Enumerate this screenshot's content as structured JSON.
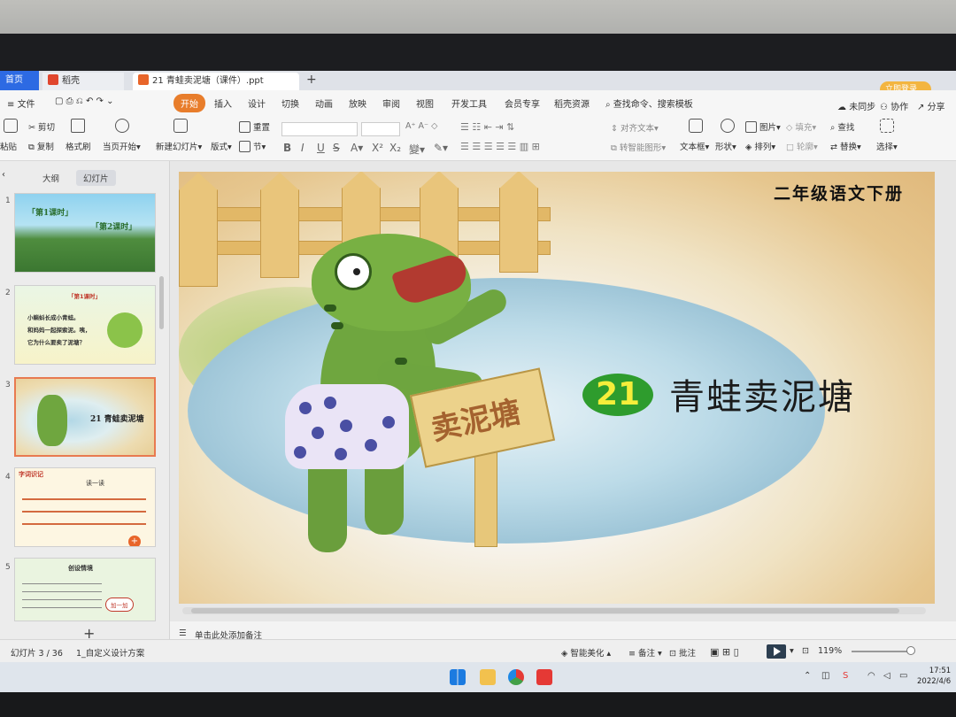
{
  "window": {
    "tabs": {
      "home": "首页",
      "docer": "稻壳",
      "document": "21 青蛙卖泥塘（课件）.ppt"
    },
    "login_button": "立即登录"
  },
  "menu": {
    "file": "文件",
    "items": [
      "开始",
      "插入",
      "设计",
      "切换",
      "动画",
      "放映",
      "审阅",
      "视图",
      "开发工具",
      "会员专享",
      "稻壳资源"
    ],
    "search": "查找命令、搜索模板",
    "right": [
      "未同步",
      "协作",
      "分享"
    ]
  },
  "ribbon": {
    "paste": "粘贴",
    "cut": "剪切",
    "copy": "复制",
    "format_painter": "格式刷",
    "from_current": "当页开始",
    "new_slide": "新建幻灯片",
    "layout": "版式",
    "reset": "重置",
    "section": "节",
    "align_text": "对齐文本",
    "smart_shape": "转智能图形",
    "textbox": "文本框",
    "shape": "形状",
    "picture": "图片",
    "arrange": "排列",
    "fill": "填充",
    "outline": "轮廓",
    "find": "查找",
    "replace": "替换",
    "select": "选择"
  },
  "sidebar": {
    "tabs": [
      "大纲",
      "幻灯片"
    ],
    "slides": [
      {
        "num": "1",
        "labels": [
          "「第1课时」",
          "「第2课时」"
        ]
      },
      {
        "num": "2",
        "heading": "「第1课时」",
        "lines": [
          "小蝌蚪长成小青蛙。",
          "和妈妈一起探索泥。咦，",
          "它为什么要卖了泥塘？"
        ]
      },
      {
        "num": "3",
        "title": "21 青蛙卖泥塘"
      },
      {
        "num": "4",
        "header": "字词识记",
        "sub": "读一读"
      },
      {
        "num": "5",
        "header": "创设情境",
        "bubble": "加一加"
      }
    ]
  },
  "slide": {
    "grade": "二年级语文下册",
    "number": "21",
    "title": "青蛙卖泥塘",
    "sign": "卖泥塘"
  },
  "notes_placeholder": "单击此处添加备注",
  "status": {
    "slide_count": "幻灯片 3 / 36",
    "theme": "1_自定义设计方案",
    "beautify": "智能美化",
    "notes": "备注",
    "comments": "批注",
    "zoom": "119%"
  },
  "taskbar": {
    "time": "17:51",
    "date": "2022/4/6"
  }
}
